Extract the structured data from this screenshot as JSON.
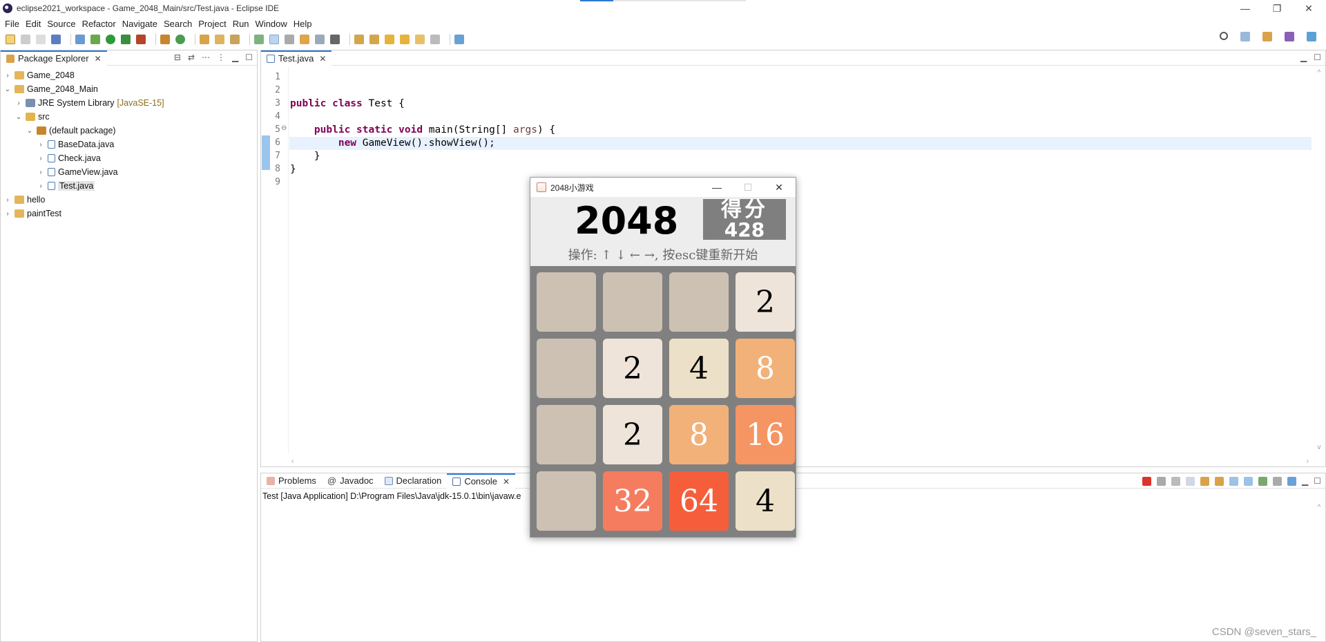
{
  "window": {
    "title": "eclipse2021_workspace - Game_2048_Main/src/Test.java - Eclipse IDE",
    "minimize": "—",
    "restore": "❐",
    "close": "✕"
  },
  "menu": [
    "File",
    "Edit",
    "Source",
    "Refactor",
    "Navigate",
    "Search",
    "Project",
    "Run",
    "Window",
    "Help"
  ],
  "package_explorer": {
    "tab_label": "Package Explorer",
    "items": [
      {
        "label": "Game_2048",
        "indent": 0,
        "arrow": "›",
        "icon": "project-icon",
        "sub": ""
      },
      {
        "label": "Game_2048_Main",
        "indent": 0,
        "arrow": "⌄",
        "icon": "project-icon",
        "sub": ""
      },
      {
        "label": "JRE System Library",
        "indent": 1,
        "arrow": "›",
        "icon": "library-icon",
        "sub": "[JavaSE-15]"
      },
      {
        "label": "src",
        "indent": 1,
        "arrow": "⌄",
        "icon": "folder-icon",
        "sub": ""
      },
      {
        "label": "(default package)",
        "indent": 2,
        "arrow": "⌄",
        "icon": "package-icon",
        "sub": ""
      },
      {
        "label": "BaseData.java",
        "indent": 3,
        "arrow": "›",
        "icon": "java-file-icon",
        "sub": ""
      },
      {
        "label": "Check.java",
        "indent": 3,
        "arrow": "›",
        "icon": "java-file-icon",
        "sub": ""
      },
      {
        "label": "GameView.java",
        "indent": 3,
        "arrow": "›",
        "icon": "java-file-icon",
        "sub": ""
      },
      {
        "label": "Test.java",
        "indent": 3,
        "arrow": "›",
        "icon": "java-file-icon",
        "sub": "",
        "selected": true
      },
      {
        "label": "hello",
        "indent": 0,
        "arrow": "›",
        "icon": "project-icon",
        "sub": ""
      },
      {
        "label": "paintTest",
        "indent": 0,
        "arrow": "›",
        "icon": "project-icon",
        "sub": ""
      }
    ]
  },
  "editor": {
    "tab_label": "Test.java",
    "line_numbers": [
      "1",
      "2",
      "3",
      "4",
      "5",
      "6",
      "7",
      "8",
      "9"
    ],
    "fold_marker": "⊖",
    "code": {
      "l3_kw": "public class",
      "l3_rest": " Test {",
      "l5_kw": "public static void",
      "l5_mid": " main(String[] ",
      "l5_param": "args",
      "l5_end": ") {",
      "l6_kw": "new",
      "l6_rest": " GameView().showView();",
      "l7": "}",
      "l8": "}"
    }
  },
  "bottom_panel": {
    "tabs": [
      "Problems",
      "Javadoc",
      "Declaration",
      "Console"
    ],
    "active_tab": "Console",
    "console_line": "Test [Java Application] D:\\Program Files\\Java\\jdk-15.0.1\\bin\\javaw.e"
  },
  "game": {
    "window_title": "2048小游戏",
    "minimize": "—",
    "maximize": "☐",
    "close": "✕",
    "logo": "2048",
    "score_label": "得分",
    "score": "428",
    "help": "操作: ↑ ↓ ← →, 按esc键重新开始",
    "board": [
      [
        "",
        "",
        "",
        "2"
      ],
      [
        "",
        "2",
        "4",
        "8"
      ],
      [
        "",
        "2",
        "8",
        "16"
      ],
      [
        "",
        "32",
        "64",
        "4"
      ]
    ],
    "tile_colors": {
      "": "#cdc1b4",
      "2": "#eee4da",
      "4": "#ede0c8",
      "8": "#f2b179",
      "16": "#f59563",
      "32": "#f67c5f",
      "64": "#f65e3b"
    },
    "tile_text_colors": {
      "2": "#000000",
      "4": "#000000",
      "8": "#ffffff",
      "16": "#ffffff",
      "32": "#ffffff",
      "64": "#ffffff"
    }
  },
  "watermark": "CSDN @seven_stars_"
}
